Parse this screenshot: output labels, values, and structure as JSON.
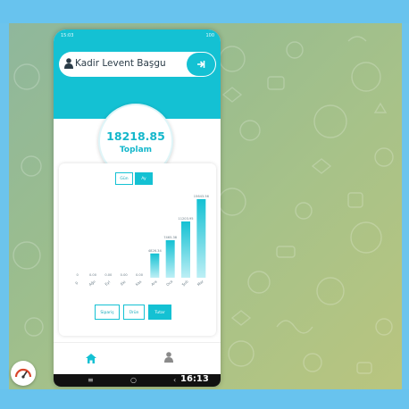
{
  "status_bar": {
    "left": "15:03",
    "right": "100"
  },
  "user": {
    "name": "Kadir Levent Başgu"
  },
  "summary": {
    "total_value": "18218.85",
    "total_label": "Toplam"
  },
  "period_toggle": {
    "options": [
      "Gün",
      "Ay"
    ],
    "selected": "Ay"
  },
  "filter_toggle": {
    "options": [
      "Sipariş",
      "Ürün",
      "Tutar"
    ],
    "selected": "Tutar"
  },
  "clock": "16:13",
  "colors": {
    "accent": "#14c1d3",
    "wallpaper": "#9bbd8e",
    "band": "#68c3ee"
  },
  "icons": {
    "user": "user-icon",
    "logout": "logout-icon",
    "home": "home-icon",
    "profile": "user-icon",
    "gauge": "gauge-icon"
  },
  "chart_data": {
    "type": "bar",
    "categories": [
      "0",
      "Ağu",
      "Eyl",
      "Eki",
      "Kas",
      "Ara",
      "Oca",
      "Şub",
      "Mar"
    ],
    "values": [
      0,
      0,
      0,
      0,
      0,
      4826.34,
      7465.38,
      11203.95,
      15643.56
    ],
    "data_labels": [
      "0",
      "0.00",
      "0.00",
      "0.00",
      "0.00",
      "4826.34",
      "7465.38",
      "11203.95",
      "15643.56"
    ],
    "ylim": [
      0,
      16000
    ],
    "grid": false,
    "title": "",
    "xlabel": "",
    "ylabel": ""
  }
}
